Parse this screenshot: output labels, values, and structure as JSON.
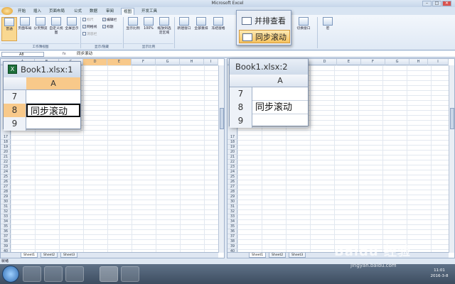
{
  "app": {
    "title": "Microsoft Excel",
    "min": "–",
    "max": "□",
    "close": "✕"
  },
  "tabs": [
    "开始",
    "插入",
    "页面布局",
    "公式",
    "数据",
    "审阅",
    "视图",
    "开发工具"
  ],
  "active_tab": "视图",
  "ribbon": {
    "groups": [
      "工作簿视图",
      "显示/隐藏",
      "显示比例"
    ],
    "view_buttons": [
      "普通",
      "页面布局",
      "分页预览",
      "自定义视图",
      "全屏显示"
    ],
    "checks": [
      {
        "label": "标尺",
        "checked": true
      },
      {
        "label": "编辑栏",
        "checked": true
      },
      {
        "label": "网格线",
        "checked": true
      },
      {
        "label": "标题",
        "checked": true
      },
      {
        "label": "消息栏",
        "checked": false
      }
    ],
    "zoom_buttons": [
      "显示比例",
      "100%",
      "缩放到选定区域"
    ],
    "window_buttons": [
      "新建窗口",
      "全部重排",
      "冻结窗格"
    ],
    "extra_buttons": [
      "切换窗口",
      "宏"
    ],
    "popup": {
      "side_by_side": "并排查看",
      "sync_scroll": "同步滚动"
    }
  },
  "formula_bar": {
    "name_box": "A8",
    "fx": "fx",
    "value": "同步滚动"
  },
  "left_window": {
    "title": "Book1.xlsx:1",
    "columns": [
      "A",
      "B",
      "C",
      "D",
      "E",
      "F",
      "G",
      "H",
      "I"
    ],
    "rows": [
      "7",
      "8",
      "9",
      "17",
      "18",
      "19",
      "20",
      "21",
      "22",
      "23",
      "24",
      "25",
      "26",
      "27",
      "28",
      "29",
      "30",
      "31",
      "32",
      "33",
      "34",
      "35",
      "36",
      "37",
      "38",
      "39",
      "40",
      "41",
      "42",
      "43",
      "44",
      "45",
      "46"
    ],
    "zoom_cols": [
      "A"
    ],
    "zoom_rows": [
      {
        "n": "7",
        "v": ""
      },
      {
        "n": "8",
        "v": "同步滚动"
      },
      {
        "n": "9",
        "v": ""
      }
    ],
    "sheets": [
      "Sheet1",
      "Sheet2",
      "Sheet3"
    ]
  },
  "right_window": {
    "title": "Book1.xlsx:2",
    "columns": [
      "D",
      "E",
      "F",
      "G",
      "H",
      "I",
      "J"
    ],
    "rows": [
      "17",
      "18",
      "19",
      "20",
      "21",
      "22",
      "23",
      "24",
      "25",
      "26",
      "27",
      "28",
      "29",
      "30",
      "31",
      "32",
      "33",
      "34",
      "35",
      "36",
      "37",
      "38",
      "39",
      "40",
      "41",
      "42",
      "43",
      "44",
      "45",
      "46"
    ],
    "zoom_cols": [
      "A"
    ],
    "zoom_rows": [
      {
        "n": "7",
        "v": ""
      },
      {
        "n": "8",
        "v": "同步滚动"
      },
      {
        "n": "9",
        "v": ""
      }
    ],
    "sheets": [
      "Sheet1",
      "Sheet2",
      "Sheet3"
    ]
  },
  "status": {
    "ready": "就绪"
  },
  "taskbar": {
    "time": "11:01",
    "date": "2016-3-8"
  },
  "watermark": {
    "brand": "Baidu 经验",
    "url": "jingyan.baidu.com"
  }
}
